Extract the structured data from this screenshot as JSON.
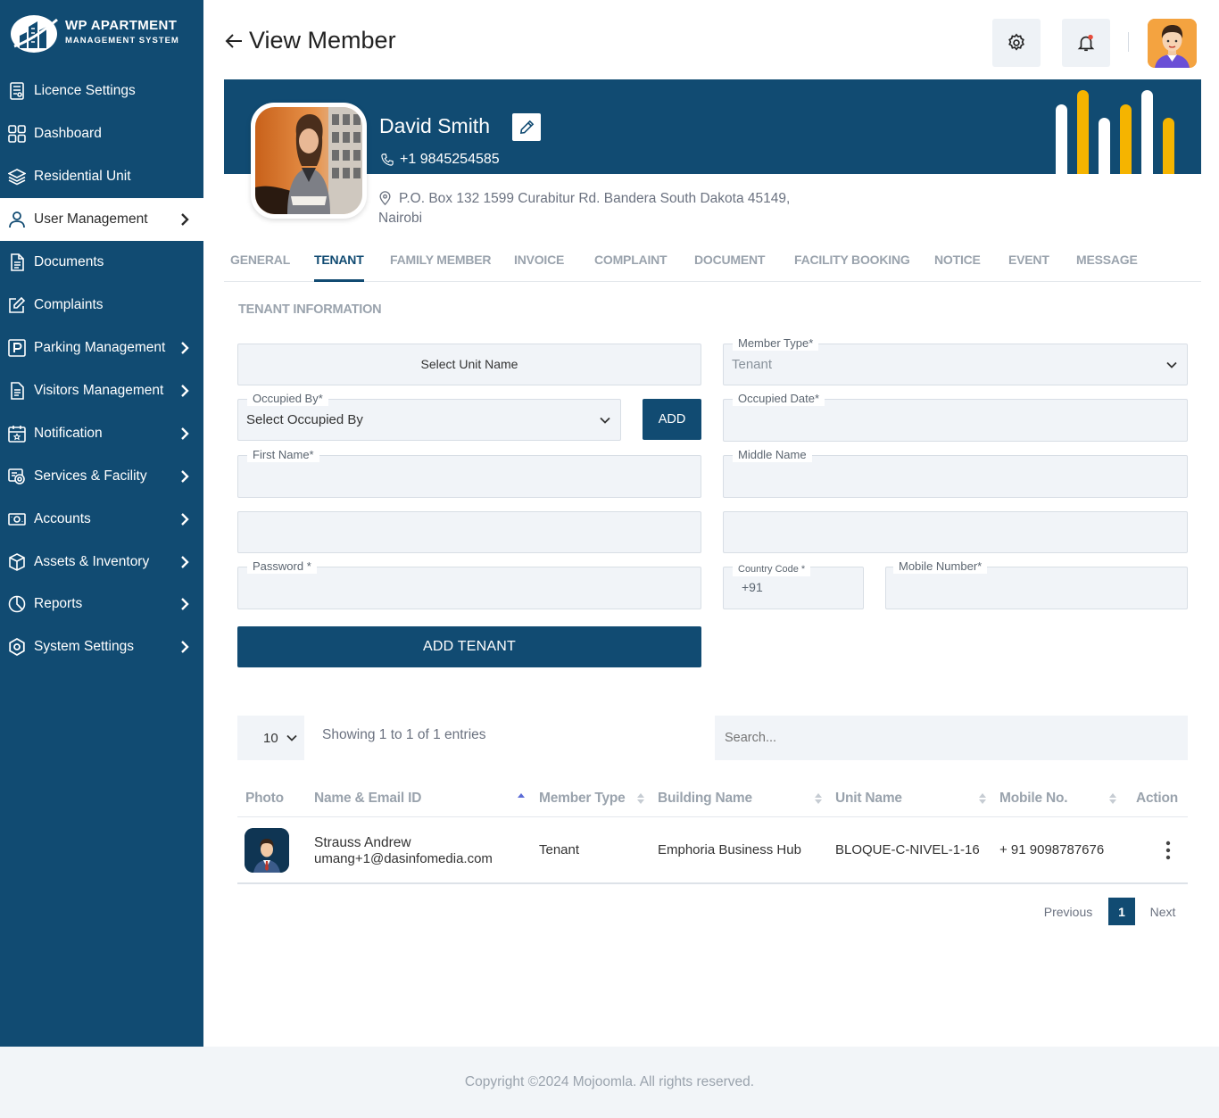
{
  "brand": {
    "title": "WP APARTMENT",
    "subtitle": "MANAGEMENT SYSTEM"
  },
  "sidebar": {
    "items": [
      {
        "label": "Licence Settings",
        "icon": "licence-icon",
        "has_children": false
      },
      {
        "label": "Dashboard",
        "icon": "dashboard-icon",
        "has_children": false
      },
      {
        "label": "Residential Unit",
        "icon": "layers-icon",
        "has_children": false
      },
      {
        "label": "User Management",
        "icon": "user-icon",
        "has_children": true,
        "active": true
      },
      {
        "label": "Documents",
        "icon": "document-icon",
        "has_children": false
      },
      {
        "label": "Complaints",
        "icon": "edit-icon",
        "has_children": false
      },
      {
        "label": "Parking Management",
        "icon": "parking-icon",
        "has_children": true
      },
      {
        "label": "Visitors Management",
        "icon": "clipboard-icon",
        "has_children": true
      },
      {
        "label": "Notification",
        "icon": "calendar-icon",
        "has_children": true
      },
      {
        "label": "Services & Facility",
        "icon": "services-icon",
        "has_children": true
      },
      {
        "label": "Accounts",
        "icon": "money-icon",
        "has_children": true
      },
      {
        "label": "Assets & Inventory",
        "icon": "box-icon",
        "has_children": true
      },
      {
        "label": "Reports",
        "icon": "pie-chart-icon",
        "has_children": true
      },
      {
        "label": "System Settings",
        "icon": "settings-icon",
        "has_children": true
      }
    ]
  },
  "header": {
    "title": "View Member"
  },
  "member": {
    "name": "David Smith",
    "phone": "+1  9845254585",
    "address": "P.O. Box 132 1599 Curabitur Rd. Bandera South Dakota 45149, Nairobi"
  },
  "colors": {
    "primary": "#114b72",
    "accent": "#f5b400",
    "field_bg": "#f1f4f8"
  },
  "tabs": [
    {
      "label": "GENERAL",
      "active": false
    },
    {
      "label": "TENANT",
      "active": true
    },
    {
      "label": "FAMILY MEMBER",
      "active": false
    },
    {
      "label": "INVOICE",
      "active": false
    },
    {
      "label": "COMPLAINT",
      "active": false
    },
    {
      "label": "DOCUMENT",
      "active": false
    },
    {
      "label": "FACILITY BOOKING",
      "active": false
    },
    {
      "label": "NOTICE",
      "active": false
    },
    {
      "label": "EVENT",
      "active": false
    },
    {
      "label": "MESSAGE",
      "active": false
    }
  ],
  "form": {
    "section_title": "TENANT INFORMATION",
    "unit_name": {
      "value": "Select Unit Name"
    },
    "member_type": {
      "label": "Member Type*",
      "value": "Tenant"
    },
    "occupied_by": {
      "label": "Occupied By*",
      "value": "Select Occupied By"
    },
    "add_button": "ADD",
    "occupied_date": {
      "label": "Occupied Date*",
      "value": ""
    },
    "first_name": {
      "label": "First Name*",
      "value": ""
    },
    "middle_name": {
      "label": "Middle Name",
      "value": ""
    },
    "field_5": {
      "value": ""
    },
    "field_6": {
      "value": ""
    },
    "password": {
      "label": "Password *",
      "value": ""
    },
    "country_code": {
      "label": "Country Code *",
      "value": "+91"
    },
    "mobile_number": {
      "label": "Mobile Number*",
      "value": ""
    },
    "submit": "ADD TENANT"
  },
  "table": {
    "page_length": "10",
    "info": "Showing 1 to 1 of 1 entries",
    "search_placeholder": "Search...",
    "columns": [
      "Photo",
      "Name & Email ID",
      "Member Type",
      "Building Name",
      "Unit Name",
      "Mobile No.",
      "Action"
    ],
    "rows": [
      {
        "name": "Strauss Andrew",
        "email": "umang+1@dasinfomedia.com",
        "member_type": "Tenant",
        "building": "Emphoria Business Hub",
        "unit": "BLOQUE-C-NIVEL-1-16",
        "mobile": "+ 91 9098787676"
      }
    ],
    "pagination": {
      "previous": "Previous",
      "current": "1",
      "next": "Next"
    }
  },
  "footer": {
    "copyright": "Copyright ©2024 Mojoomla. All rights reserved."
  }
}
